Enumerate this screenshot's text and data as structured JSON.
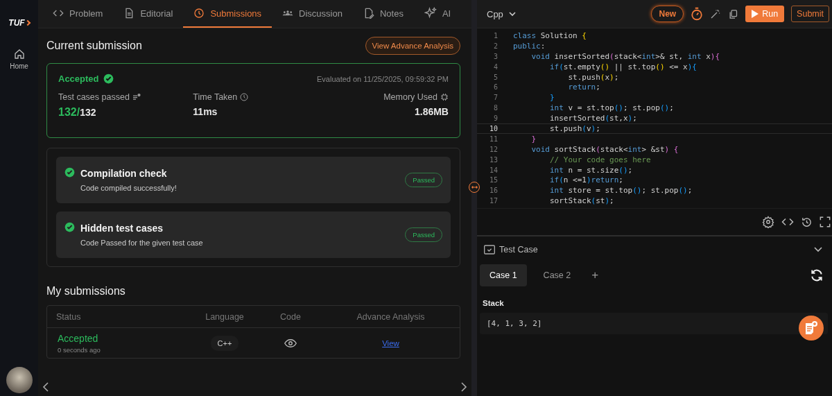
{
  "sidebar": {
    "logo": "TUF",
    "items": [
      {
        "label": "Home",
        "selected": false
      }
    ]
  },
  "tabs": [
    {
      "label": "Problem",
      "kind": "code",
      "selected": false
    },
    {
      "label": "Editorial",
      "kind": "doc",
      "selected": false
    },
    {
      "label": "Submissions",
      "kind": "clock",
      "selected": true
    },
    {
      "label": "Discussion",
      "kind": "people",
      "selected": false
    },
    {
      "label": "Notes",
      "kind": "note",
      "selected": false
    },
    {
      "label": "AI",
      "kind": "sparkle",
      "selected": false
    }
  ],
  "current_submission": {
    "title": "Current submission",
    "analysis_button": "View Advance Analysis",
    "status": "Accepted",
    "evaluated": "Evaluated on 11/25/2025, 09:59:32 PM",
    "stats": [
      {
        "label": "Test cases passed",
        "kind": "list",
        "passed": "132/",
        "total": "132"
      },
      {
        "label": "Time Taken",
        "kind": "clock",
        "total": "11ms"
      },
      {
        "label": "Memory Used",
        "kind": "chip",
        "total": "1.86MB"
      }
    ]
  },
  "checks": [
    {
      "title": "Compilation check",
      "detail": "Code compiled successfully!",
      "badge": "Passed"
    },
    {
      "title": "Hidden test cases",
      "detail": "Code Passed for the given test case",
      "badge": "Passed"
    }
  ],
  "my_submissions": {
    "title": "My submissions",
    "columns": [
      "Status",
      "Language",
      "Code",
      "Advance Analysis"
    ],
    "rows": [
      {
        "status": "Accepted",
        "time": "0 seconds ago",
        "language": "C++",
        "link": "View"
      }
    ]
  },
  "editor": {
    "language": "Cpp",
    "new_button": "New",
    "run_button": "Run",
    "submit_button": "Submit",
    "lines": [
      {
        "number": "1",
        "current": false,
        "tokens": [
          {
            "text": "class",
            "kind": "kw"
          },
          {
            "text": " Solution ",
            "kind": "tx"
          },
          {
            "text": "{",
            "kind": "b1"
          }
        ]
      },
      {
        "number": "2",
        "current": false,
        "tokens": [
          {
            "text": "public",
            "kind": "kw"
          },
          {
            "text": ":",
            "kind": "tx"
          }
        ]
      },
      {
        "number": "3",
        "current": false,
        "tokens": [
          {
            "text": "    void",
            "kind": "kw"
          },
          {
            "text": " insertSorted",
            "kind": "tx"
          },
          {
            "text": "(",
            "kind": "b2"
          },
          {
            "text": "stack<",
            "kind": "tx"
          },
          {
            "text": "int",
            "kind": "kw"
          },
          {
            "text": ">& st, ",
            "kind": "tx"
          },
          {
            "text": "int",
            "kind": "kw"
          },
          {
            "text": " x",
            "kind": "tx"
          },
          {
            "text": "){",
            "kind": "b2"
          }
        ]
      },
      {
        "number": "4",
        "current": false,
        "tokens": [
          {
            "text": "        if",
            "kind": "kw"
          },
          {
            "text": "(",
            "kind": "b3"
          },
          {
            "text": "st.empty",
            "kind": "tx"
          },
          {
            "text": "()",
            "kind": "b1"
          },
          {
            "text": " || st.top",
            "kind": "tx"
          },
          {
            "text": "()",
            "kind": "b1"
          },
          {
            "text": " <= x",
            "kind": "tx"
          },
          {
            "text": "){",
            "kind": "b3"
          }
        ]
      },
      {
        "number": "5",
        "current": false,
        "tokens": [
          {
            "text": "            st.push",
            "kind": "tx"
          },
          {
            "text": "(",
            "kind": "b1"
          },
          {
            "text": "x",
            "kind": "tx"
          },
          {
            "text": ")",
            "kind": "b1"
          },
          {
            "text": ";",
            "kind": "tx"
          }
        ]
      },
      {
        "number": "6",
        "current": false,
        "tokens": [
          {
            "text": "            return",
            "kind": "kw"
          },
          {
            "text": ";",
            "kind": "tx"
          }
        ]
      },
      {
        "number": "7",
        "current": false,
        "tokens": [
          {
            "text": "        }",
            "kind": "b3"
          }
        ]
      },
      {
        "number": "8",
        "current": false,
        "tokens": [
          {
            "text": "        int",
            "kind": "kw"
          },
          {
            "text": " v = st.top",
            "kind": "tx"
          },
          {
            "text": "()",
            "kind": "b3"
          },
          {
            "text": "; st.pop",
            "kind": "tx"
          },
          {
            "text": "()",
            "kind": "b3"
          },
          {
            "text": ";",
            "kind": "tx"
          }
        ]
      },
      {
        "number": "9",
        "current": false,
        "tokens": [
          {
            "text": "        insertSorted",
            "kind": "tx"
          },
          {
            "text": "(",
            "kind": "b3"
          },
          {
            "text": "st,x",
            "kind": "tx"
          },
          {
            "text": ")",
            "kind": "b3"
          },
          {
            "text": ";",
            "kind": "tx"
          }
        ]
      },
      {
        "number": "10",
        "current": true,
        "tokens": [
          {
            "text": "        st.push",
            "kind": "tx"
          },
          {
            "text": "(",
            "kind": "b3"
          },
          {
            "text": "v",
            "kind": "tx"
          },
          {
            "text": ")",
            "kind": "b3"
          },
          {
            "text": ";",
            "kind": "tx"
          }
        ]
      },
      {
        "number": "11",
        "current": false,
        "tokens": [
          {
            "text": "    }",
            "kind": "b2"
          }
        ]
      },
      {
        "number": "12",
        "current": false,
        "tokens": [
          {
            "text": "    void",
            "kind": "kw"
          },
          {
            "text": " sortStack",
            "kind": "tx"
          },
          {
            "text": "(",
            "kind": "b2"
          },
          {
            "text": "stack<",
            "kind": "tx"
          },
          {
            "text": "int",
            "kind": "kw"
          },
          {
            "text": "> &st",
            "kind": "tx"
          },
          {
            "text": ")",
            "kind": "b2"
          },
          {
            "text": " {",
            "kind": "b2"
          }
        ]
      },
      {
        "number": "13",
        "current": false,
        "tokens": [
          {
            "text": "        // Your code goes here",
            "kind": "cm"
          }
        ]
      },
      {
        "number": "14",
        "current": false,
        "tokens": [
          {
            "text": "        int",
            "kind": "kw"
          },
          {
            "text": " n = st.size",
            "kind": "tx"
          },
          {
            "text": "()",
            "kind": "b3"
          },
          {
            "text": ";",
            "kind": "tx"
          }
        ]
      },
      {
        "number": "15",
        "current": false,
        "tokens": [
          {
            "text": "        if",
            "kind": "kw"
          },
          {
            "text": "(",
            "kind": "b3"
          },
          {
            "text": "n <=1",
            "kind": "tx"
          },
          {
            "text": ")",
            "kind": "b3"
          },
          {
            "text": "return",
            "kind": "kw"
          },
          {
            "text": ";",
            "kind": "tx"
          }
        ]
      },
      {
        "number": "16",
        "current": false,
        "tokens": [
          {
            "text": "        int",
            "kind": "kw"
          },
          {
            "text": " store = st.top",
            "kind": "tx"
          },
          {
            "text": "()",
            "kind": "b3"
          },
          {
            "text": "; st.pop",
            "kind": "tx"
          },
          {
            "text": "()",
            "kind": "b3"
          },
          {
            "text": ";",
            "kind": "tx"
          }
        ]
      },
      {
        "number": "17",
        "current": false,
        "tokens": [
          {
            "text": "        sortStack",
            "kind": "tx"
          },
          {
            "text": "(",
            "kind": "b3"
          },
          {
            "text": "st",
            "kind": "tx"
          },
          {
            "text": ")",
            "kind": "b3"
          },
          {
            "text": ";",
            "kind": "tx"
          }
        ]
      }
    ]
  },
  "test_panel": {
    "title": "Test Case",
    "cases": [
      {
        "label": "Case 1",
        "selected": true
      },
      {
        "label": "Case 2",
        "selected": false
      }
    ],
    "add": "+",
    "input_label": "Stack",
    "input_value": "[4, 1, 3, 2]"
  }
}
